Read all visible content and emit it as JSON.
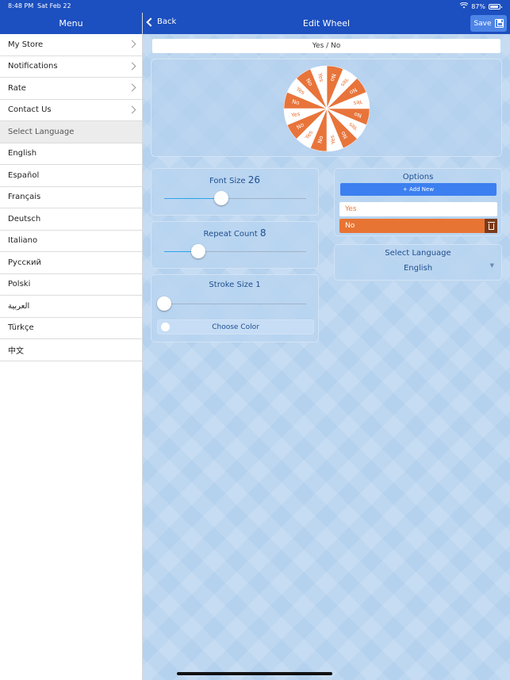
{
  "status_bar": {
    "time": "8:48 PM",
    "date": "Sat Feb 22",
    "battery": "87%",
    "battery_level": 0.87
  },
  "sidebar": {
    "title": "Menu",
    "items": [
      {
        "label": "My Store",
        "chevron": true
      },
      {
        "label": "Notifications",
        "chevron": true
      },
      {
        "label": "Rate",
        "chevron": true
      },
      {
        "label": "Contact Us",
        "chevron": true
      }
    ],
    "section_label": "Select Language",
    "languages": [
      "English",
      "Español",
      "Français",
      "Deutsch",
      "Italiano",
      "Русский",
      "Polski",
      "العربية",
      "Türkçe",
      "中文"
    ]
  },
  "navbar": {
    "back_label": "Back",
    "title": "Edit Wheel",
    "save_label": "Save"
  },
  "wheel": {
    "name": "Yes / No",
    "segment_count": 16,
    "labels": [
      "Yes",
      "No"
    ],
    "colors": {
      "yes_fill": "#ffffff",
      "yes_text": "#e8743a",
      "no_fill": "#e8743a",
      "no_text": "#ffffff"
    }
  },
  "font_size": {
    "label": "Font Size",
    "value": "26",
    "level": 0.4
  },
  "repeat_count": {
    "label": "Repeat Count",
    "value": "8",
    "level": 0.24
  },
  "stroke_size": {
    "label": "Stroke Size",
    "value": "1",
    "level": 0.0
  },
  "choose_color_label": "Choose Color",
  "options": {
    "title": "Options",
    "add_new_label": "+ Add New",
    "items": [
      "Yes",
      "No"
    ]
  },
  "language_select": {
    "label": "Select Language",
    "value": "English"
  },
  "colors": {
    "primary": "#1c4fbf",
    "accent_blue": "#3c7ff0",
    "orange": "#e8743a",
    "background": "#b4d1ee"
  }
}
